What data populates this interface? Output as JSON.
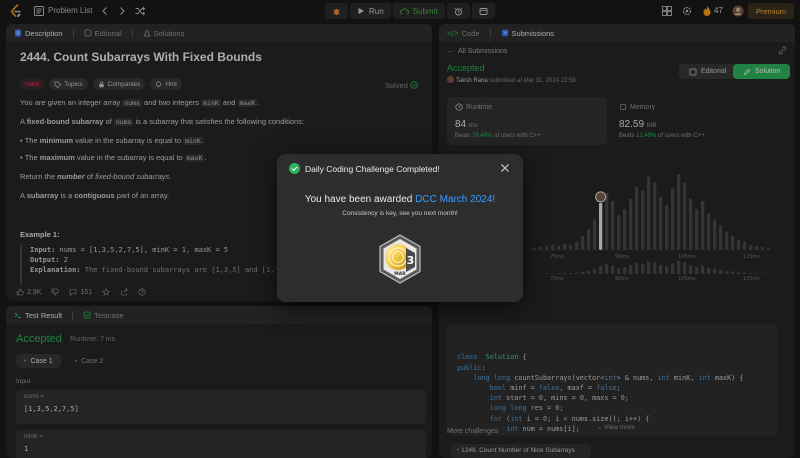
{
  "topbar": {
    "problem_list": "Problem List",
    "run": "Run",
    "submit": "Submit",
    "streak": "47",
    "premium": "Premium"
  },
  "left": {
    "tabs": [
      "Description",
      "Editorial",
      "Solutions"
    ],
    "title": "2444. Count Subarrays With Fixed Bounds",
    "solved": "Solved",
    "chips": [
      "Hard",
      "Topics",
      "Companies",
      "Hint"
    ],
    "p1": {
      "a": "You are given an integer array ",
      "c1": "nums",
      "b": " and two integers ",
      "c2": "minK",
      "c": " and ",
      "c3": "maxK",
      "d": "."
    },
    "p2": {
      "a": "A ",
      "b": "fixed-bound subarray",
      "c": " of ",
      "c1": "nums",
      "d": " is a subarray that satisfies the following conditions:"
    },
    "b1": {
      "a": "The ",
      "b": "minimum",
      "c": " value in the subarray is equal to ",
      "c1": "minK",
      "d": "."
    },
    "b2": {
      "a": "The ",
      "b": "maximum",
      "c": " value in the subarray is equal to ",
      "c1": "maxK",
      "d": "."
    },
    "p3": {
      "a": "Return the ",
      "b": "number",
      "c": " of ",
      "d": "fixed-bound subarrays",
      "e": "."
    },
    "p4": {
      "a": "A ",
      "b": "subarray",
      "c": " is a ",
      "d": "contiguous",
      "e": " part of an array."
    },
    "example_title": "Example 1:",
    "ex_input_label": "Input:",
    "ex_input": " nums = [1,3,5,2,7,5], minK = 1, maxK = 5",
    "ex_output_label": "Output:",
    "ex_output": " 2",
    "ex_expl_label": "Explanation:",
    "ex_expl": " The fixed-bound subarrays are [1,3,5] and [1,",
    "likes": "2.9K",
    "comments": "151"
  },
  "test": {
    "tabs": [
      "Test Result",
      "Testcase"
    ],
    "status": "Accepted",
    "runtime": "Runtime: 7 ms",
    "cases": [
      "Case 1",
      "Case 2"
    ],
    "input_label": "Input",
    "nums_label": "nums =",
    "nums_value": "[1,3,5,2,7,5]",
    "mink_label": "minK =",
    "mink_value": "1"
  },
  "right": {
    "tabs": [
      "Code",
      "Submissions"
    ],
    "all_submissions": "All Submissions",
    "status": "Accepted",
    "user": "Taksh Rana",
    "submitted": " submitted at Mar 31, 2024 22:59",
    "editorial": "Editorial",
    "solution": "Solution",
    "runtime_title": "Runtime",
    "runtime_value": "84",
    "runtime_unit": "ms",
    "runtime_beats_label": "Beats",
    "runtime_beats_pct": "78.46%",
    "runtime_beats_suffix": " of users with C++",
    "memory_title": "Memory",
    "memory_value": "82.59",
    "memory_unit": "MB",
    "memory_beats_label": "Beats",
    "memory_beats_pct": "12.49%",
    "memory_beats_suffix": " of users with C++",
    "axis1": [
      "75ms",
      "90ms",
      "106ms",
      "125ms"
    ],
    "axis2": [
      "75ms",
      "90ms",
      "106ms",
      "125ms"
    ],
    "view_more": "View more",
    "more_challenges": "More challenges",
    "nice": "1248. Count Number of Nice Subarrays"
  },
  "code_lines": [
    [
      [
        "kw",
        "class"
      ],
      [
        "",
        "  "
      ],
      [
        "ty",
        "Solution"
      ],
      [
        "",
        " {"
      ]
    ],
    [
      [
        "kw",
        "public"
      ],
      [
        "",
        ":"
      ]
    ],
    [
      [
        "",
        "    "
      ],
      [
        "kw",
        "long long"
      ],
      [
        "",
        " countSubarrays(vector<"
      ],
      [
        "kw",
        "int"
      ],
      [
        "",
        "> & nums, "
      ],
      [
        "kw",
        "int"
      ],
      [
        "",
        " minK, "
      ],
      [
        "kw",
        "int"
      ],
      [
        "",
        " maxK) {"
      ]
    ],
    [
      [
        "",
        "        "
      ],
      [
        "kw",
        "bool"
      ],
      [
        "",
        " minf = "
      ],
      [
        "kw",
        "false"
      ],
      [
        "",
        ", maxf = "
      ],
      [
        "kw",
        "false"
      ],
      [
        "",
        ";"
      ]
    ],
    [
      [
        "",
        "        "
      ],
      [
        "kw",
        "int"
      ],
      [
        "",
        " start = "
      ],
      [
        "nm",
        "0"
      ],
      [
        "",
        ", mins = "
      ],
      [
        "nm",
        "0"
      ],
      [
        "",
        ", maxs = "
      ],
      [
        "nm",
        "0"
      ],
      [
        "",
        ";"
      ]
    ],
    [
      [
        "",
        "        "
      ],
      [
        "kw",
        "long long"
      ],
      [
        "",
        " res = "
      ],
      [
        "nm",
        "0"
      ],
      [
        "",
        ";"
      ]
    ],
    [
      [
        "",
        "        "
      ],
      [
        "kw",
        "for"
      ],
      [
        "",
        " ("
      ],
      [
        "kw",
        "int"
      ],
      [
        "",
        " i = "
      ],
      [
        "nm",
        "0"
      ],
      [
        "",
        "; i < nums.size(); i++) {"
      ]
    ],
    [
      [
        "",
        "            "
      ],
      [
        "kw",
        "int"
      ],
      [
        "",
        " num = nums[i];"
      ]
    ]
  ],
  "chart_data": {
    "type": "bar",
    "title": "",
    "x_ticks": [
      "75ms",
      "90ms",
      "106ms",
      "125ms"
    ],
    "values": [
      2,
      3,
      4,
      5,
      4,
      6,
      5,
      8,
      14,
      20,
      30,
      46,
      56,
      48,
      34,
      40,
      50,
      62,
      58,
      72,
      66,
      52,
      44,
      60,
      74,
      66,
      50,
      40,
      48,
      36,
      30,
      24,
      18,
      14,
      10,
      8,
      5,
      4,
      3,
      2
    ],
    "highlight_index": 11,
    "ylim": [
      0,
      80
    ]
  },
  "modal": {
    "title": "Daily Coding Challenge Completed!",
    "award_prefix": "You have been awarded ",
    "award_name": "DCC March 2024!",
    "subtitle": "Consistency is key, see you next month!",
    "badge_number": "3",
    "badge_month": "MAR"
  },
  "colors": {
    "accent_green": "#2db55d",
    "hard_red": "#ff375f",
    "link_blue": "#3b9cff",
    "premium_orange": "#ffb53f"
  }
}
